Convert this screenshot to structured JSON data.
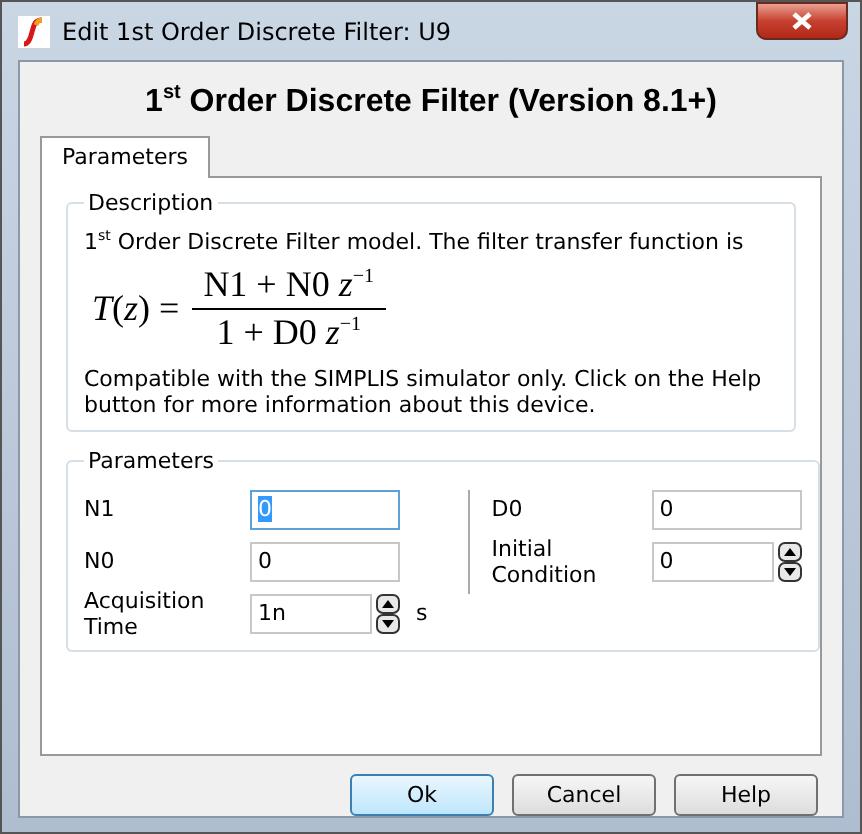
{
  "window": {
    "title": "Edit 1st Order Discrete Filter: U9"
  },
  "heading": "1$^{st}$ Order Discrete Filter (Version 8.1+)",
  "tabs": [
    {
      "label": "Parameters",
      "selected": true
    }
  ],
  "description": {
    "title": "Description",
    "intro": "1$^{st}$ Order Discrete Filter model. The filter transfer function is",
    "formula": {
      "lhs": "*T*(*z*) =",
      "numerator": "N1 + N0 *z*$^{−1}$",
      "denominator": "1 + D0 *z*$^{−1}$"
    },
    "note": "Compatible with the SIMPLIS simulator only. Click on the Help button for more information about this device."
  },
  "parameters": {
    "title": "Parameters",
    "columns": [
      [
        {
          "label": "N1",
          "value": "0",
          "kind": "text",
          "focused": true
        },
        {
          "label": "N0",
          "value": "0",
          "kind": "text",
          "focused": false
        },
        {
          "label": "Acquisition Time",
          "value": "1n",
          "kind": "spin",
          "unit": "s",
          "focused": false
        }
      ],
      [
        {
          "label": "D0",
          "value": "0",
          "kind": "text",
          "focused": false
        },
        {
          "label": "Initial Condition",
          "value": "0",
          "kind": "spin",
          "focused": false
        }
      ]
    ]
  },
  "buttons": [
    {
      "label": "Ok",
      "default": true
    },
    {
      "label": "Cancel",
      "default": false
    },
    {
      "label": "Help",
      "default": false
    }
  ]
}
